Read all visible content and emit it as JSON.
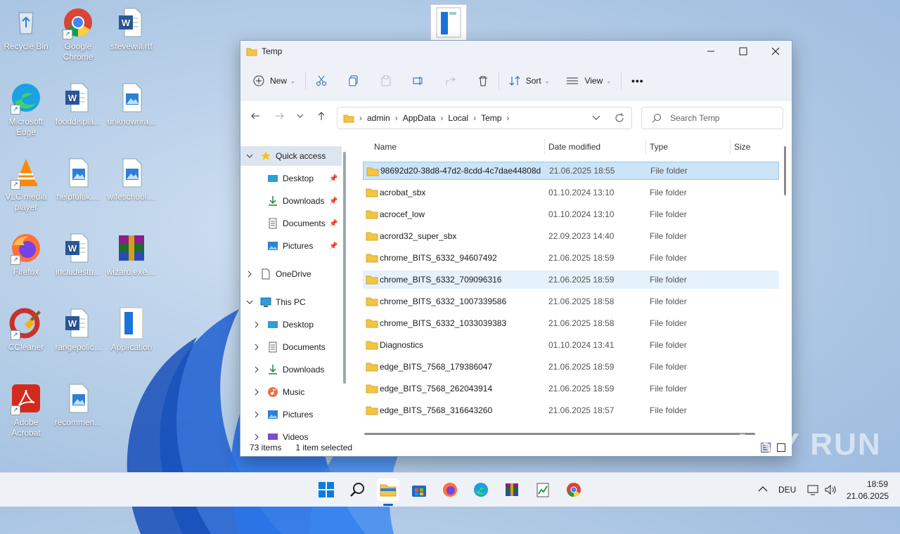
{
  "desktop": {
    "icons": [
      {
        "label": "Recycle Bin",
        "icon": "recycle-bin-icon"
      },
      {
        "label": "Google Chrome",
        "icon": "chrome-icon"
      },
      {
        "label": "stevewill.rtf",
        "icon": "word-icon"
      },
      {
        "label": "Microsoft Edge",
        "icon": "edge-icon"
      },
      {
        "label": "fooddispla...",
        "icon": "word-icon"
      },
      {
        "label": "unknownra...",
        "icon": "image-icon"
      },
      {
        "label": "VLC media player",
        "icon": "vlc-icon"
      },
      {
        "label": "helpfuluk....",
        "icon": "image-icon"
      },
      {
        "label": "wifeschool....",
        "icon": "image-icon"
      },
      {
        "label": "Firefox",
        "icon": "firefox-icon"
      },
      {
        "label": "includestu...",
        "icon": "word-icon"
      },
      {
        "label": "wizard.exe....",
        "icon": "winrar-icon"
      },
      {
        "label": "CCleaner",
        "icon": "ccleaner-icon"
      },
      {
        "label": "rangepolic...",
        "icon": "word-icon"
      },
      {
        "label": "Application",
        "icon": "application-icon"
      },
      {
        "label": "Adobe Acrobat",
        "icon": "acrobat-icon"
      },
      {
        "label": "recommen...",
        "icon": "image-icon"
      }
    ]
  },
  "window": {
    "title": "Temp",
    "toolbar": {
      "new_label": "New",
      "sort_label": "Sort",
      "view_label": "View",
      "more_label": "•••"
    },
    "address": {
      "crumbs": [
        "admin",
        "AppData",
        "Local",
        "Temp"
      ]
    },
    "search": {
      "placeholder": "Search Temp"
    },
    "nav": {
      "quick_access": "Quick access",
      "qa_items": [
        "Desktop",
        "Downloads",
        "Documents",
        "Pictures"
      ],
      "onedrive": "OneDrive",
      "this_pc": "This PC",
      "pc_items": [
        "Desktop",
        "Documents",
        "Downloads",
        "Music",
        "Pictures",
        "Videos"
      ]
    },
    "columns": {
      "name": "Name",
      "date": "Date modified",
      "type": "Type",
      "size": "Size"
    },
    "rows": [
      {
        "name": "98692d20-38d8-47d2-8cdd-4c7dae44808d",
        "date": "21.06.2025 18:55",
        "type": "File folder"
      },
      {
        "name": "acrobat_sbx",
        "date": "01.10.2024 13:10",
        "type": "File folder"
      },
      {
        "name": "acrocef_low",
        "date": "01.10.2024 13:10",
        "type": "File folder"
      },
      {
        "name": "acrord32_super_sbx",
        "date": "22.09.2023 14:40",
        "type": "File folder"
      },
      {
        "name": "chrome_BITS_6332_94607492",
        "date": "21.06.2025 18:59",
        "type": "File folder"
      },
      {
        "name": "chrome_BITS_6332_709096316",
        "date": "21.06.2025 18:59",
        "type": "File folder"
      },
      {
        "name": "chrome_BITS_6332_1007339586",
        "date": "21.06.2025 18:58",
        "type": "File folder"
      },
      {
        "name": "chrome_BITS_6332_1033039383",
        "date": "21.06.2025 18:58",
        "type": "File folder"
      },
      {
        "name": "Diagnostics",
        "date": "01.10.2024 13:41",
        "type": "File folder"
      },
      {
        "name": "edge_BITS_7568_179386047",
        "date": "21.06.2025 18:59",
        "type": "File folder"
      },
      {
        "name": "edge_BITS_7568_262043914",
        "date": "21.06.2025 18:59",
        "type": "File folder"
      },
      {
        "name": "edge_BITS_7568_316643260",
        "date": "21.06.2025 18:57",
        "type": "File folder"
      }
    ],
    "status": {
      "count": "73 items",
      "selected": "1 item selected"
    }
  },
  "taskbar": {
    "lang": "DEU",
    "time": "18:59",
    "date": "21.06.2025"
  },
  "watermark": "ANY RUN",
  "colors": {
    "accent": "#0067c0",
    "selection": "#cce4f7",
    "folder": "#f4c542"
  }
}
